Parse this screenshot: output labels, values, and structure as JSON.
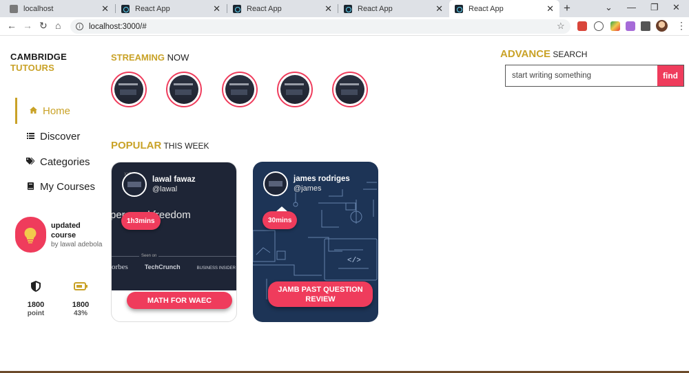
{
  "browser": {
    "tabs": [
      {
        "title": "localhost",
        "icon": "page-icon"
      },
      {
        "title": "React App",
        "icon": "react-icon"
      },
      {
        "title": "React App",
        "icon": "react-icon"
      },
      {
        "title": "React App",
        "icon": "react-icon"
      },
      {
        "title": "React App",
        "icon": "react-icon",
        "active": true
      }
    ],
    "url": "localhost:3000/#"
  },
  "brand": {
    "line1": "CAMBRIDGE",
    "line2": "TUTOURS",
    "accent_color": "#c9a227"
  },
  "nav": [
    {
      "label": "Home",
      "icon": "home-icon",
      "active": true
    },
    {
      "label": "Discover",
      "icon": "list-icon"
    },
    {
      "label": "Categories",
      "icon": "tags-icon"
    },
    {
      "label": "My Courses",
      "icon": "book-icon"
    }
  ],
  "update": {
    "title": "updated course",
    "by": "by lawal adebola",
    "icon": "lightbulb-icon",
    "color": "#ef3c5c"
  },
  "stats": [
    {
      "value": "1800",
      "label": "point",
      "icon": "shield-icon"
    },
    {
      "value": "1800",
      "label": "43%",
      "icon": "battery-icon"
    }
  ],
  "streaming": {
    "accent": "STREAMING",
    "rest": " NOW",
    "count": 5
  },
  "popular": {
    "accent": "POPULAR",
    "rest": " THIS WEEK",
    "cards": [
      {
        "author": "lawal fawaz",
        "handle": "@lawal",
        "duration": "1h3mins",
        "cta": "MATH FOR WAEC",
        "image_text": "personal freedom",
        "seen_on": "Seen on",
        "press_logos": [
          "orbes",
          "TechCrunch",
          "BUSINESS INSIDER"
        ]
      },
      {
        "author": "james rodriges",
        "handle": "@james",
        "duration": "30mins",
        "cta": "JAMB PAST QUESTION REVIEW"
      }
    ]
  },
  "search": {
    "accent": "ADVANCE",
    "rest": " SEARCH",
    "placeholder": "start writing something",
    "button": "find"
  }
}
